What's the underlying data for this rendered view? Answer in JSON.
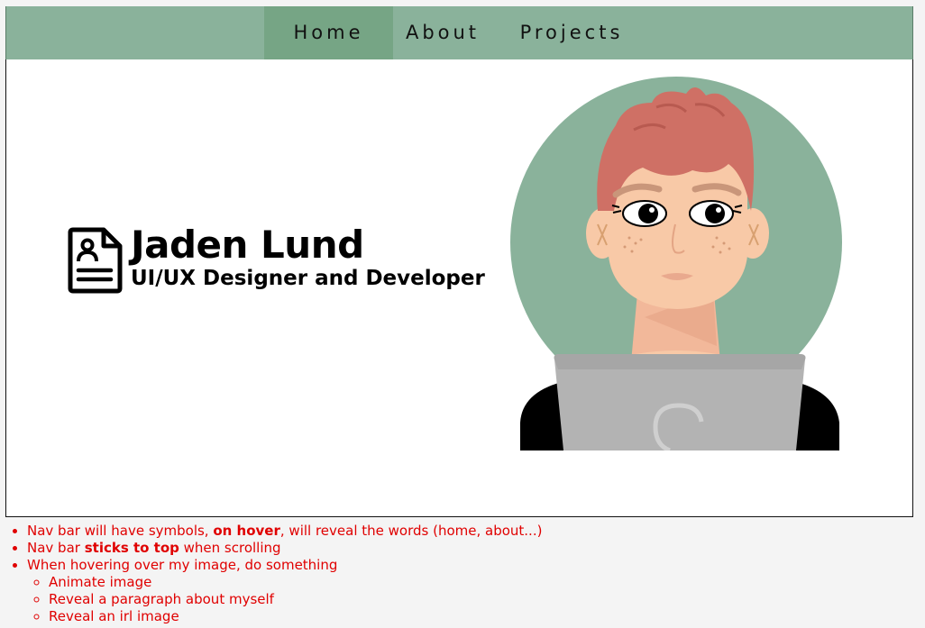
{
  "nav": {
    "items": [
      {
        "label": "Home",
        "active": true
      },
      {
        "label": "About",
        "active": false
      },
      {
        "label": "Projects",
        "active": false
      }
    ],
    "colors": {
      "bar": "#8ab29b",
      "active": "#76a585"
    }
  },
  "hero": {
    "icon": "resume-document-icon",
    "name": "Jaden Lund",
    "role": "UI/UX Designer and Developer",
    "avatar_icon": "developer-avatar-illustration"
  },
  "notes": {
    "color": "#e00000",
    "items": [
      {
        "pre": "Nav bar will have symbols, ",
        "bold": "on hover",
        "post": ", will reveal the words (home, about...)"
      },
      {
        "pre": "Nav bar ",
        "bold": "sticks to top",
        "post": " when scrolling"
      },
      {
        "pre": "When hovering over my image, do something",
        "bold": "",
        "post": ""
      }
    ],
    "sub_items": [
      "Animate image",
      "Reveal a paragraph about myself",
      "Reveal an irl image"
    ]
  }
}
